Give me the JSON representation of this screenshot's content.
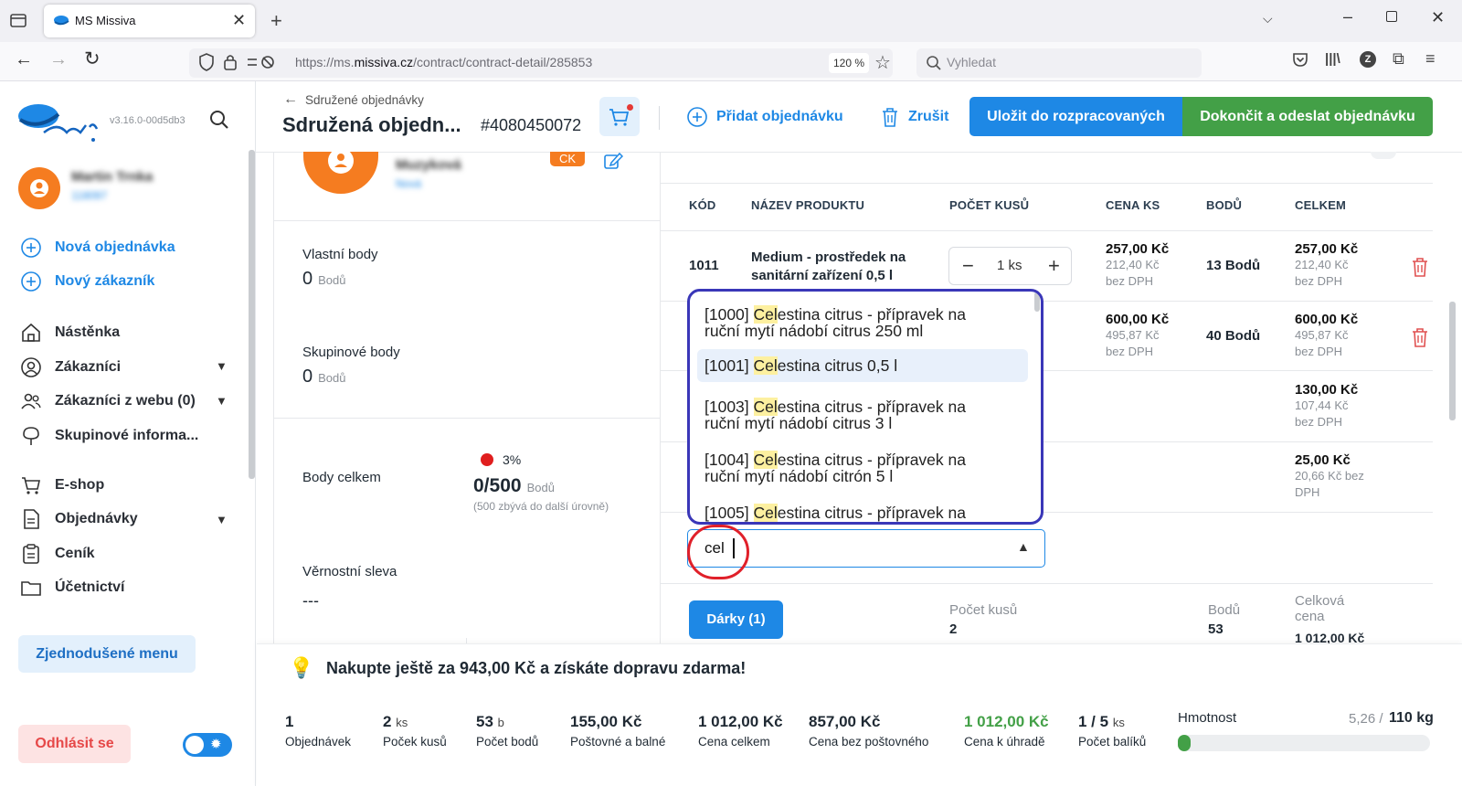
{
  "browser": {
    "tab_title": "MS Missiva",
    "url_prefix": "https://ms.",
    "url_domain": "missiva.cz",
    "url_path": "/contract/contract-detail/285853",
    "zoom": "120 %",
    "search_placeholder": "Vyhledat"
  },
  "app": {
    "version": "v3.16.0-00d5db3",
    "user_name": "Martin Trnka",
    "user_code": "118097",
    "sidebar": {
      "new_order": "Nová objednávka",
      "new_customer": "Nový zákazník",
      "items": [
        {
          "label": "Nástěnka",
          "icon": "home-icon"
        },
        {
          "label": "Zákazníci",
          "icon": "user-circle-icon"
        },
        {
          "label": "Zákazníci z webu (0)",
          "icon": "users-icon"
        },
        {
          "label": "Skupinové informa...",
          "icon": "tree-icon"
        },
        {
          "label": "E-shop",
          "icon": "cart-icon"
        },
        {
          "label": "Objednávky",
          "icon": "document-icon"
        },
        {
          "label": "Ceník",
          "icon": "clipboard-icon"
        },
        {
          "label": "Účetnictví",
          "icon": "folder-icon"
        }
      ],
      "simplified_menu": "Zjednodušené menu",
      "logout": "Odhlásit se"
    }
  },
  "header": {
    "breadcrumb": "Sdružené objednávky",
    "title": "Sdružená objedn...",
    "order_number": "#4080450072",
    "add_order": "Přidat objednávku",
    "cancel": "Zrušit",
    "save_draft": "Uložit do rozpracovaných",
    "finish": "Dokončit a odeslat objednávku"
  },
  "customer_panel": {
    "customer_name": "Muzyková",
    "customer_sub": "Nová",
    "badge": "CK",
    "own_points_label": "Vlastní body",
    "own_points_value": "0",
    "points_unit": "Bodů",
    "group_points_label": "Skupinové body",
    "group_points_value": "0",
    "total_points_label": "Body celkem",
    "total_percent": "3%",
    "total_value": "0/500",
    "total_note": "(500 zbývá do další úrovně)",
    "loyalty_label": "Věrnostní sleva",
    "loyalty_value": "---"
  },
  "table": {
    "headers": [
      "KÓD",
      "NÁZEV PRODUKTU",
      "POČET KUSŮ",
      "CENA KS",
      "BODŮ",
      "CELKEM"
    ],
    "rows": [
      {
        "code": "1011",
        "name_line1": "Medium - prostředek na",
        "name_line2": "sanitární zařízení 0,5 l",
        "qty": "1 ks",
        "price": "257,00 Kč",
        "price_net": "212,40 Kč",
        "net_label": "bez DPH",
        "points": "13 Bodů",
        "total": "257,00 Kč",
        "total_net": "212,40 Kč"
      },
      {
        "price": "600,00 Kč",
        "price_net": "495,87 Kč",
        "net_label": "bez DPH",
        "points": "40 Bodů",
        "total": "600,00 Kč",
        "total_net": "495,87 Kč"
      },
      {
        "total": "130,00 Kč",
        "total_net": "107,44 Kč",
        "net_label": "bez DPH"
      },
      {
        "total": "25,00 Kč",
        "total_net_line1": "20,66 Kč bez",
        "total_net_line2": "DPH"
      }
    ]
  },
  "dropdown": {
    "input_value": "cel",
    "options": [
      {
        "code": "[1000] ",
        "match": "Cel",
        "rest1": "estina citrus - přípravek na",
        "rest2": "ruční mytí nádobí citrus 250 ml"
      },
      {
        "code": "[1001] ",
        "match": "Cel",
        "rest1": "estina citrus 0,5 l",
        "rest2": ""
      },
      {
        "code": "[1003] ",
        "match": "Cel",
        "rest1": "estina citrus - přípravek na",
        "rest2": "ruční mytí nádobí citrus 3 l"
      },
      {
        "code": "[1004] ",
        "match": "Cel",
        "rest1": "estina citrus - přípravek na",
        "rest2": "ruční mytí nádobí citrón 5 l"
      },
      {
        "code": "[1005] ",
        "match": "Cel",
        "rest1": "estina citrus - přípravek na",
        "rest2": ""
      }
    ]
  },
  "summary_row": {
    "gifts_button": "Dárky (1)",
    "qty_label": "Počet kusů",
    "qty_value": "2",
    "points_label": "Bodů",
    "points_value": "53",
    "total_label_1": "Celková",
    "total_label_2": "cena",
    "total_value": "1 012,00 Kč"
  },
  "footer": {
    "free_shipping": "Nakupte ještě za 943,00 Kč a získáte dopravu zdarma!",
    "stats": [
      {
        "value": "1",
        "unit": "",
        "label": "Objednávek"
      },
      {
        "value": "2",
        "unit": "ks",
        "label": "Poček kusů"
      },
      {
        "value": "53",
        "unit": "b",
        "label": "Počet bodů"
      },
      {
        "value": "155,00 Kč",
        "unit": "",
        "label": "Poštovné a balné"
      },
      {
        "value": "1 012,00 Kč",
        "unit": "",
        "label": "Cena celkem"
      },
      {
        "value": "857,00 Kč",
        "unit": "",
        "label": "Cena bez poštovného"
      },
      {
        "value": "1 012,00 Kč",
        "unit": "",
        "label": "Cena k úhradě"
      },
      {
        "value": "1 / 5",
        "unit": "ks",
        "label": "Počet balíků"
      }
    ],
    "weight_label": "Hmotnost",
    "weight_current": "5,26 /",
    "weight_max": "110 kg",
    "weight_fraction": 0.048
  },
  "colors": {
    "primary_blue": "#1e88e5",
    "success_green": "#43a047",
    "accent_orange": "#f57c20",
    "highlight_yellow": "#fdf0a0",
    "dropdown_border": "#3a37b8",
    "annotation_red": "#e0202a"
  }
}
